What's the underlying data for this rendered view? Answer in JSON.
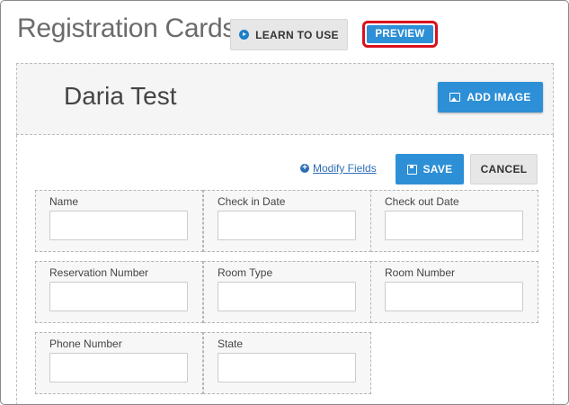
{
  "header": {
    "title": "Registration Cards",
    "learn_label": "LEARN TO USE",
    "preview_label": "PREVIEW"
  },
  "card": {
    "title": "Daria Test",
    "add_image_label": "ADD IMAGE"
  },
  "toolbar": {
    "modify_fields_label": "Modify Fields",
    "save_label": "SAVE",
    "cancel_label": "CANCEL"
  },
  "fields": [
    {
      "label": "Name",
      "value": ""
    },
    {
      "label": "Check in Date",
      "value": ""
    },
    {
      "label": "Check out Date",
      "value": ""
    },
    {
      "label": "Reservation Number",
      "value": ""
    },
    {
      "label": "Room Type",
      "value": ""
    },
    {
      "label": "Room Number",
      "value": ""
    },
    {
      "label": "Phone Number",
      "value": ""
    },
    {
      "label": "State",
      "value": ""
    }
  ],
  "colors": {
    "accent": "#2d8fd6",
    "highlight": "#d9111c",
    "link": "#2d6fb5"
  }
}
